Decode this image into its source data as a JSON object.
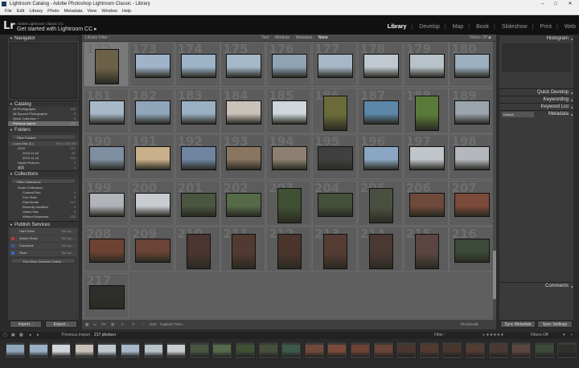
{
  "window": {
    "title": "Lightroom Catalog - Adobe Photoshop Lightroom Classic - Library"
  },
  "menu": [
    "File",
    "Edit",
    "Library",
    "Photo",
    "Metadata",
    "View",
    "Window",
    "Help"
  ],
  "identity": {
    "logo": "Lr",
    "sub": "Adobe Lightroom Classic CC",
    "main": "Get started with Lightroom CC ▸"
  },
  "modules": [
    "Library",
    "Develop",
    "Map",
    "Book",
    "Slideshow",
    "Print",
    "Web"
  ],
  "left": {
    "navigator": "Navigator",
    "catalog": {
      "title": "Catalog",
      "items": [
        {
          "label": "All Photographs",
          "count": "220"
        },
        {
          "label": "All Synced Photographs",
          "count": "0"
        },
        {
          "label": "Quick Collection +",
          "count": "0"
        },
        {
          "label": "Previous Import",
          "count": "217"
        }
      ]
    },
    "folders": {
      "title": "Folders",
      "filter": "Filter Folders",
      "volume": "Local Disk (C:)",
      "volume_size": "98.5 / 236 GB",
      "items": [
        {
          "label": "2019",
          "count": "217"
        },
        {
          "label": "2019-11-02",
          "count": "87"
        },
        {
          "label": "2019-11-16",
          "count": "130"
        },
        {
          "label": "Saved Pictures",
          "count": "2"
        },
        {
          "label": "桌面",
          "count": "1"
        }
      ]
    },
    "collections": {
      "title": "Collections",
      "filter": "Filter Collections",
      "smart": "Smart Collections",
      "items": [
        {
          "label": "Colored Red",
          "count": "0"
        },
        {
          "label": "Five Stars",
          "count": "0"
        },
        {
          "label": "Past Month",
          "count": "217"
        },
        {
          "label": "Recently Modified",
          "count": "0"
        },
        {
          "label": "Video Files",
          "count": "0"
        },
        {
          "label": "Without Keywords",
          "count": "220"
        }
      ]
    },
    "publish": {
      "title": "Publish Services",
      "items": [
        {
          "label": "Hard Drive",
          "action": "Set Up..."
        },
        {
          "label": "Adobe Stock",
          "action": "Set Up..."
        },
        {
          "label": "Facebook",
          "action": "Set Up..."
        },
        {
          "label": "Flickr",
          "action": "Set Up..."
        }
      ],
      "more": "Find More Services Online..."
    }
  },
  "filterbar": {
    "title": "Library Filter :",
    "tabs": [
      "Text",
      "Attribute",
      "Metadata",
      "None"
    ],
    "active": "None",
    "filters_off": "Filters Off ◆"
  },
  "grid": {
    "numbers": [
      "172",
      "173",
      "174",
      "175",
      "176",
      "177",
      "178",
      "179",
      "180",
      "181",
      "182",
      "183",
      "184",
      "185",
      "186",
      "187",
      "188",
      "189",
      "190",
      "191",
      "192",
      "193",
      "194",
      "195",
      "196",
      "197",
      "198",
      "199",
      "200",
      "201",
      "202",
      "203",
      "204",
      "205",
      "206",
      "207",
      "208",
      "209",
      "210",
      "211",
      "212",
      "213",
      "214",
      "215",
      "216",
      "217"
    ]
  },
  "right": {
    "histogram": "Histogram",
    "quick_develop": "Quick Develop",
    "keywording": "Keywording",
    "keyword_list": "Keyword List",
    "metadata": "Metadata",
    "metadata_preset": "Default",
    "comments": "Comments"
  },
  "toolbar": {
    "sort_label": "Sort:",
    "sort_value": "Capture Time ÷",
    "thumbnails": "Thumbnails"
  },
  "buttons": {
    "import": "Import...",
    "export": "Export...",
    "sync_metadata": "Sync Metadata",
    "sync_settings": "Sync Settings"
  },
  "filmstrip_bar": {
    "source": "Previous Import",
    "count": "217 photos",
    "filter_label": "Filter :",
    "filters_off": "Filters Off"
  },
  "colors": {
    "accent": "#ffffff",
    "panel": "#3a3a3a",
    "grid": "#5f5f5f"
  }
}
